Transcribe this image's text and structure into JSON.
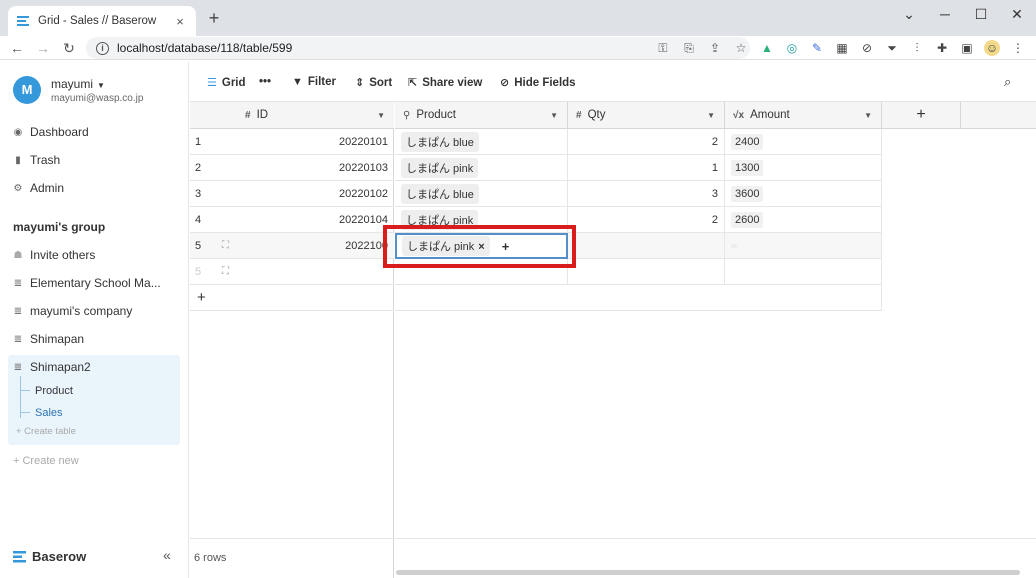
{
  "browser": {
    "tab_title": "Grid - Sales // Baserow",
    "tab_close": "×",
    "new_tab": "+",
    "url": "localhost/database/118/table/599",
    "window_minimize": "─",
    "window_maximize": "☐",
    "window_close": "✕"
  },
  "sidebar": {
    "avatar_letter": "M",
    "user_name": "mayumi",
    "user_email": "mayumi@wasp.co.jp",
    "nav": [
      {
        "label": "Dashboard",
        "icon": "dashboard-icon"
      },
      {
        "label": "Trash",
        "icon": "trash-icon"
      },
      {
        "label": "Admin",
        "icon": "admin-icon"
      }
    ],
    "group_title": "mayumi's group",
    "invite": "Invite others",
    "databases": [
      {
        "label": "Elementary School Ma..."
      },
      {
        "label": "mayumi's company"
      },
      {
        "label": "Shimapan"
      },
      {
        "label": "Shimapan2"
      }
    ],
    "tables": [
      {
        "label": "Product"
      },
      {
        "label": "Sales"
      }
    ],
    "create_table": "+ Create table",
    "create_new": "+ Create new",
    "brand": "Baserow",
    "collapse": "«"
  },
  "toolbar": {
    "view": "Grid",
    "more": "•••",
    "filter": "Filter",
    "sort": "Sort",
    "share": "Share view",
    "hide": "Hide Fields"
  },
  "grid": {
    "columns": {
      "id": "ID",
      "product": "Product",
      "qty": "Qty",
      "amount": "Amount"
    },
    "rows": [
      {
        "num": "1",
        "id": "20220101",
        "product": "しまぱん blue",
        "qty": "2",
        "amount": "2400"
      },
      {
        "num": "2",
        "id": "20220103",
        "product": "しまぱん pink",
        "qty": "1",
        "amount": "1300"
      },
      {
        "num": "3",
        "id": "20220102",
        "product": "しまぱん blue",
        "qty": "3",
        "amount": "3600"
      },
      {
        "num": "4",
        "id": "20220104",
        "product": "しまぱん pink",
        "qty": "2",
        "amount": "2600"
      },
      {
        "num": "5",
        "id": "2022100",
        "product": "しまぱん pink",
        "qty": "",
        "amount": ""
      },
      {
        "num": "5",
        "id": "",
        "product": "",
        "qty": "",
        "amount": ""
      }
    ],
    "row_count": "6 rows"
  },
  "colors": {
    "accent": "#3498db",
    "selection": "#5190c9",
    "highlight": "#d91c1c"
  }
}
